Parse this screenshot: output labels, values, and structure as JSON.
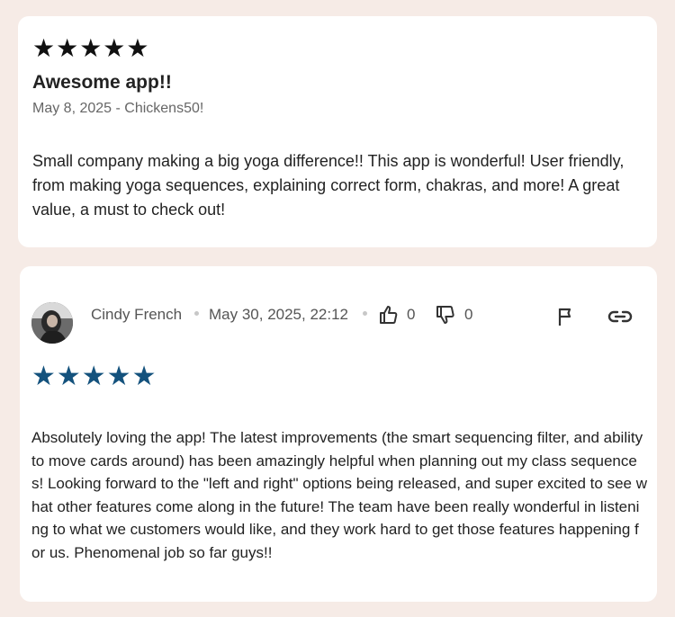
{
  "review1": {
    "stars": "★★★★★",
    "title": "Awesome app!!",
    "meta": "May 8, 2025 - Chickens50!",
    "body": "Small company making a big yoga difference!! This app is wonderful! User friendly, from making yoga sequences, explaining correct form, chakras, and more! A great value, a must to check out!"
  },
  "review2": {
    "author": "Cindy French",
    "date": "May 30, 2025, 22:12",
    "likes": "0",
    "dislikes": "0",
    "stars": "★★★★★",
    "body": "Absolutely loving the app! The latest improvements (the smart sequencing filter, and ability to move cards around) has been amazingly helpful when planning out my class sequences! Looking forward to the \"left and right\" options being released, and super excited to see what other features come along in the future! The team have been really wonderful in listening to what we customers would like, and they work hard to get those features happening for us. Phenomenal job so far guys!!"
  },
  "colors": {
    "background": "#f6ebe6",
    "card": "#ffffff",
    "star_dark": "#111111",
    "star_blue": "#14527d"
  },
  "icons": [
    "thumbs-up-icon",
    "thumbs-down-icon",
    "flag-icon",
    "link-icon"
  ]
}
